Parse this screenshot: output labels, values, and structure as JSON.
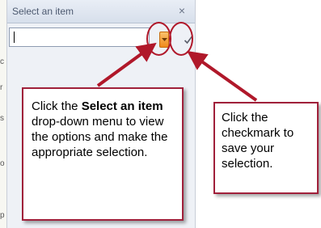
{
  "panel": {
    "title": "Select an item",
    "close_glyph": "×",
    "combo_value": "",
    "dropdown_icon": "dropdown-arrow-icon",
    "confirm_icon": "checkmark-icon"
  },
  "doc_strip_glyphs": [
    "c",
    "r",
    "s",
    "o",
    "p"
  ],
  "callouts": {
    "left": {
      "pre": "Click the ",
      "bold": "Select an item",
      "post": " drop-down menu to view the options and make the appropriate selection."
    },
    "right": {
      "text": "Click the checkmark to save your selection."
    }
  },
  "colors": {
    "annotation_red": "#b0182a",
    "dropdown_orange": "#f08a1c",
    "panel_bg": "#eef1f6"
  }
}
